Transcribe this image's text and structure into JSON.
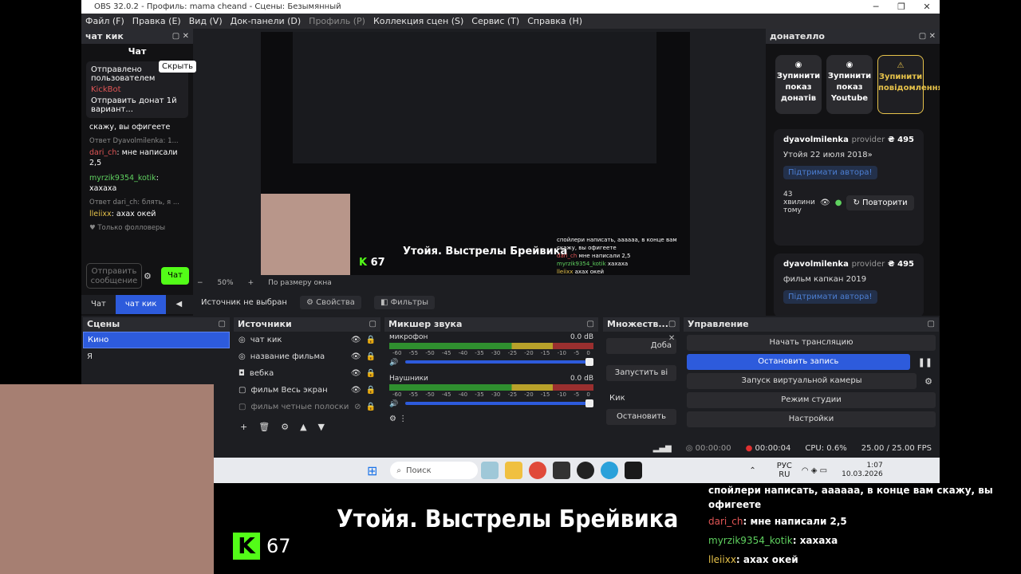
{
  "window": {
    "title": "OBS 32.0.2 - Профиль: mama cheand - Сцены: Безымянный",
    "minimize": "─",
    "maximize": "❐",
    "close": "✕"
  },
  "menu": [
    "Файл (F)",
    "Правка (E)",
    "Вид (V)",
    "Док-панели (D)",
    "Профиль (P)",
    "Коллекция сцен (S)",
    "Сервис (T)",
    "Справка (H)"
  ],
  "chat_dock": {
    "title": "чат кик",
    "header": "Чат",
    "hide_tip": "Скрыть",
    "pinned": {
      "label": "Отправлено пользователем",
      "user": "KickBot",
      "text": "Отправить донат 1й вариант..."
    },
    "snippet": "скажу, вы офигеете",
    "reply1": "Ответ Dyavolmilenka: 1...",
    "msg1_user": "dari_ch",
    "msg1_text": "мне написали 2,5",
    "msg2_user": "myrzik9354_kotik",
    "msg2_text": "хахаха",
    "reply2": "Ответ dari_ch: блять, я ...",
    "msg3_user": "lleiixx",
    "msg3_text": "ахах окей",
    "followers": "Только фолловеры",
    "input_placeholder": "Отправить сообщение",
    "send": "Чат",
    "tabs": [
      "Чат",
      "чат кик"
    ]
  },
  "preview": {
    "zoom": "50%",
    "fit": "По размеру окна",
    "overlay_title": "Утойя. Выстрелы Брейвика",
    "kick_count": "67"
  },
  "source_bar": {
    "status": "Источник не выбран",
    "props": "Свойства",
    "filters": "Фильтры"
  },
  "donatello": {
    "title": "донателло",
    "buttons": [
      "Зупинити показ донатів",
      "Зупинити показ Youtube",
      "Зупинити повідомлення"
    ],
    "cards": [
      {
        "user": "dyavolmilenka",
        "provider": "provider",
        "amount": "₴ 495",
        "text": "Утойя 22 июля 2018»",
        "support": "Підтримати автора!"
      },
      {
        "user": "dyavolmilenka",
        "provider": "provider",
        "amount": "₴ 495",
        "text": "фильм капкан 2019",
        "support": "Підтримати автора!"
      }
    ],
    "time_ago": "43 хвилини тому",
    "repeat": "Повторити"
  },
  "scenes": {
    "title": "Сцены",
    "items": [
      "Кино",
      "Я"
    ]
  },
  "sources": {
    "title": "Источники",
    "items": [
      "чат кик",
      "название фильма",
      "вебка",
      "фильм Весь экран",
      "фильм четные полоски"
    ]
  },
  "mixer": {
    "title": "Микшер звука",
    "channels": [
      {
        "name": "микрофон",
        "db": "0.0 dB"
      },
      {
        "name": "Наушники",
        "db": "0.0 dB"
      }
    ],
    "scale": [
      "-60",
      "-55",
      "-50",
      "-45",
      "-40",
      "-35",
      "-30",
      "-25",
      "-20",
      "-15",
      "-10",
      "-5",
      "0"
    ]
  },
  "multi": {
    "title": "Множеств...",
    "add": "Доба",
    "start": "Запустить ві",
    "kick": "Кик",
    "stop": "Остановить"
  },
  "controls": {
    "title": "Управление",
    "buttons": [
      "Начать трансляцию",
      "Остановить запись",
      "Запуск виртуальной камеры",
      "Режим студии",
      "Настройки"
    ]
  },
  "status": {
    "stream": "00:00:00",
    "rec": "00:00:04",
    "cpu": "CPU: 0.6%",
    "fps": "25.00 / 25.00 FPS"
  },
  "taskbar": {
    "search": "Поиск",
    "lang": "РУС",
    "lang2": "RU",
    "time": "1:07",
    "date": "10.03.2026"
  },
  "overlay": {
    "title": "Утойя. Выстрелы Брейвика",
    "kick_count": "67",
    "chat_line0": "спойлери написать, аааааа, в конце вам скажу, вы офигеете",
    "chat": [
      {
        "user": "dari_ch",
        "text": "мне написали 2,5",
        "color": "#e05555"
      },
      {
        "user": "myrzik9354_kotik",
        "text": "хахаха",
        "color": "#5fd15f"
      },
      {
        "user": "lleiixx",
        "text": "ахах окей",
        "color": "#e6c24a"
      }
    ]
  }
}
